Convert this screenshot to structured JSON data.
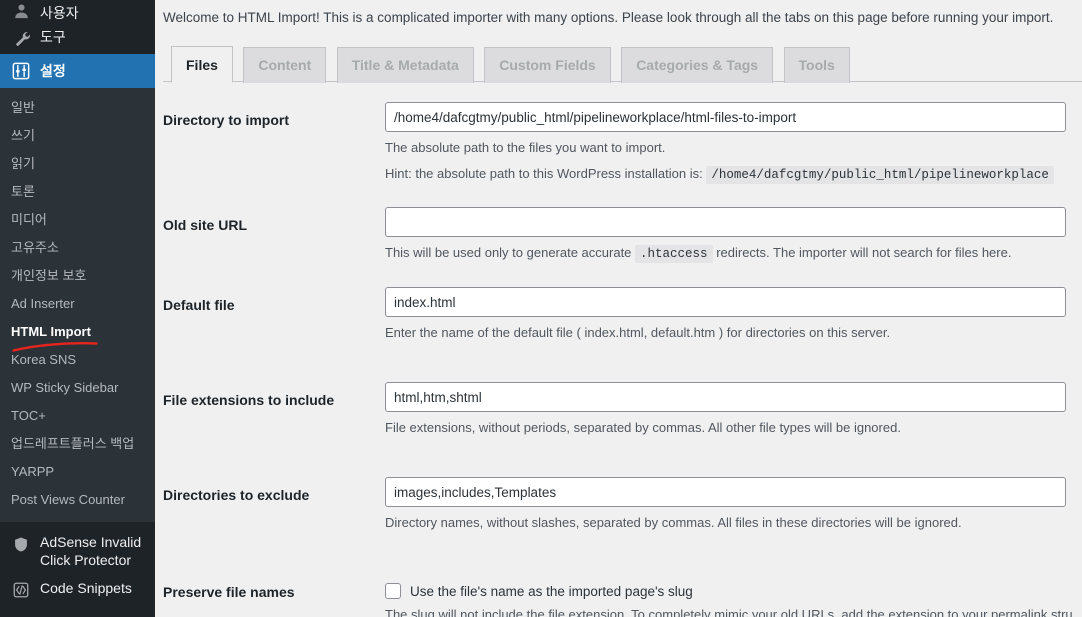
{
  "sidebar": {
    "top_items": [
      {
        "label": "사용자",
        "icon": "users-icon",
        "partial": true
      },
      {
        "label": "도구",
        "icon": "wrench-icon",
        "partial": false
      },
      {
        "label": "설정",
        "icon": "sliders-icon",
        "partial": false,
        "current": true
      }
    ],
    "submenu": [
      {
        "label": "일반",
        "active": false
      },
      {
        "label": "쓰기",
        "active": false
      },
      {
        "label": "읽기",
        "active": false
      },
      {
        "label": "토론",
        "active": false
      },
      {
        "label": "미디어",
        "active": false
      },
      {
        "label": "고유주소",
        "active": false
      },
      {
        "label": "개인정보 보호",
        "active": false
      },
      {
        "label": "Ad Inserter",
        "active": false
      },
      {
        "label": "HTML Import",
        "active": true
      },
      {
        "label": "Korea SNS",
        "active": false
      },
      {
        "label": "WP Sticky Sidebar",
        "active": false
      },
      {
        "label": "TOC+",
        "active": false
      },
      {
        "label": "업드레프트플러스 백업",
        "active": false
      },
      {
        "label": "YARPP",
        "active": false
      },
      {
        "label": "Post Views Counter",
        "active": false
      }
    ],
    "plugins": [
      {
        "label": "AdSense Invalid Click Protector",
        "icon": "shield-icon"
      },
      {
        "label": "Code Snippets",
        "icon": "code-brackets-icon"
      }
    ],
    "annotation": {
      "color": "#e8241f",
      "target": "HTML Import"
    }
  },
  "main": {
    "welcome": "Welcome to HTML Import! This is a complicated importer with many options. Please look through all the tabs on this page before running your import.",
    "tabs": [
      {
        "label": "Files",
        "active": true
      },
      {
        "label": "Content",
        "active": false
      },
      {
        "label": "Title & Metadata",
        "active": false
      },
      {
        "label": "Custom Fields",
        "active": false
      },
      {
        "label": "Categories & Tags",
        "active": false
      },
      {
        "label": "Tools",
        "active": false
      }
    ],
    "rows": {
      "directory": {
        "label": "Directory to import",
        "value": "/home4/dafcgtmy/public_html/pipelineworkplace/html-files-to-import",
        "desc": "The absolute path to the files you want to import.",
        "hint_prefix": "Hint: the absolute path to this WordPress installation is:",
        "hint_code": "/home4/dafcgtmy/public_html/pipelineworkplace"
      },
      "old_site_url": {
        "label": "Old site URL",
        "value": "",
        "desc_before": "This will be used only to generate accurate",
        "desc_code": ".htaccess",
        "desc_after": "redirects. The importer will not search for files here."
      },
      "default_file": {
        "label": "Default file",
        "value": "index.html",
        "desc": "Enter the name of the default file ( index.html, default.htm ) for directories on this server."
      },
      "file_extensions": {
        "label": "File extensions to include",
        "value": "html,htm,shtml",
        "desc": "File extensions, without periods, separated by commas. All other file types will be ignored."
      },
      "dirs_exclude": {
        "label": "Directories to exclude",
        "value": "images,includes,Templates",
        "desc": "Directory names, without slashes, separated by commas. All files in these directories will be ignored."
      },
      "preserve_names": {
        "label": "Preserve file names",
        "checkbox_label": "Use the file's name as the imported page's slug",
        "checked": false,
        "desc": "The slug will not include the file extension. To completely mimic your old URLs, add the extension to your permalink stru"
      }
    }
  }
}
